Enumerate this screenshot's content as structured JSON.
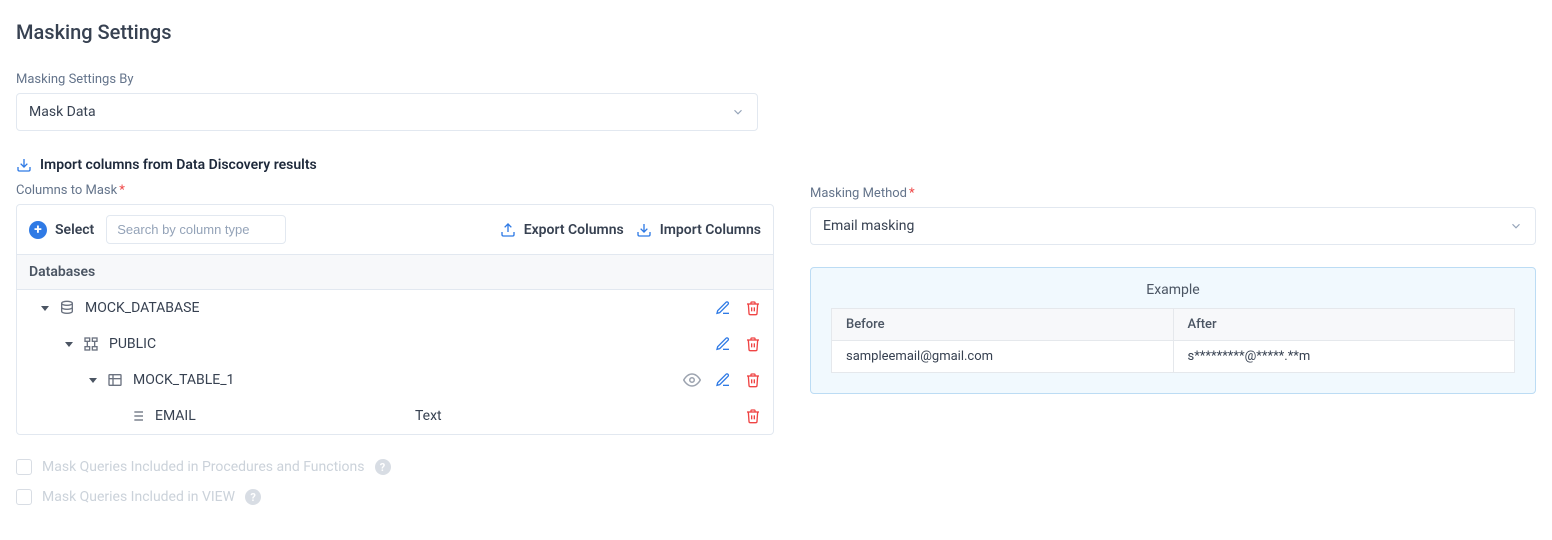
{
  "page": {
    "title": "Masking Settings"
  },
  "maskingBy": {
    "label": "Masking Settings By",
    "value": "Mask Data"
  },
  "importLink": {
    "label": "Import columns from Data Discovery results"
  },
  "columnsSection": {
    "label": "Columns to Mask",
    "toolbar": {
      "selectLabel": "Select",
      "searchPlaceholder": "Search by column type",
      "exportLabel": "Export Columns",
      "importLabel": "Import Columns"
    },
    "headerLabel": "Databases",
    "tree": {
      "database": "MOCK_DATABASE",
      "schema": "PUBLIC",
      "table": "MOCK_TABLE_1",
      "column": {
        "name": "EMAIL",
        "type": "Text"
      }
    }
  },
  "checks": {
    "procs": "Mask Queries Included in Procedures and Functions",
    "views": "Mask Queries Included in VIEW"
  },
  "method": {
    "label": "Masking Method",
    "value": "Email masking"
  },
  "example": {
    "title": "Example",
    "beforeHeader": "Before",
    "afterHeader": "After",
    "beforeValue": "sampleemail@gmail.com",
    "afterValue": "s*********@*****.**m"
  }
}
